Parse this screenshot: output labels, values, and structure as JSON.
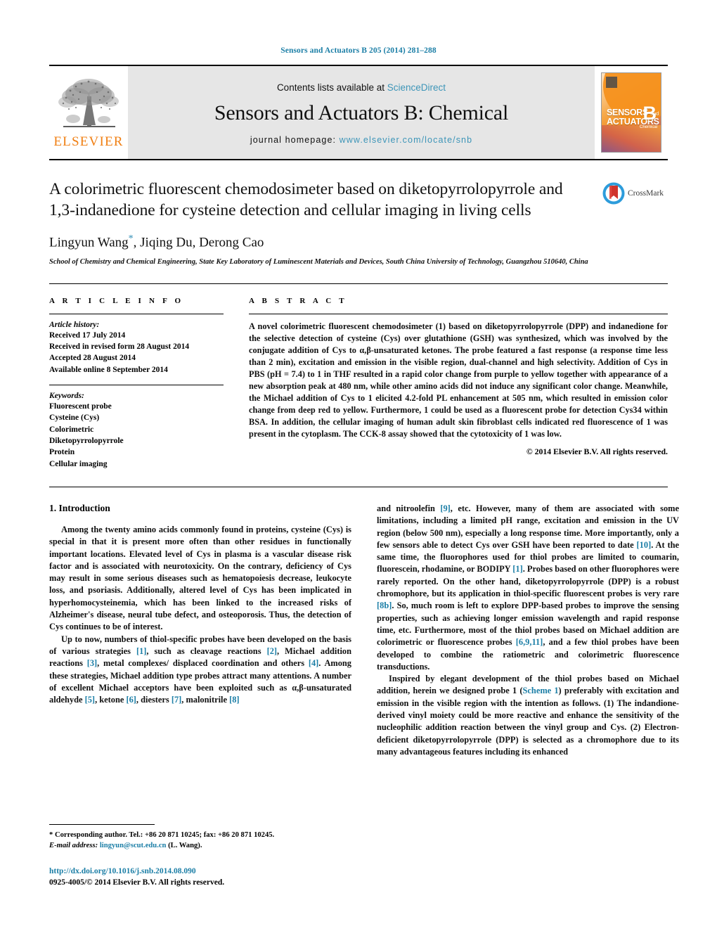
{
  "running_head": "Sensors and Actuators B 205 (2014) 281–288",
  "masthead": {
    "publisher_name": "ELSEVIER",
    "contents_prefix": "Contents lists available at ",
    "contents_link": "ScienceDirect",
    "journal_name": "Sensors and Actuators B: Chemical",
    "homepage_prefix": "journal homepage: ",
    "homepage_url": "www.elsevier.com/locate/snb",
    "cover": {
      "line1": "SENSORS",
      "and": "and",
      "line2": "ACTUATORS",
      "letter": "B",
      "sub": "Chemical"
    }
  },
  "crossmark": {
    "label": "CrossMark"
  },
  "title": "A colorimetric fluorescent chemodosimeter based on diketopyrrolopyrrole and 1,3-indanedione for cysteine detection and cellular imaging in living cells",
  "authors": "Lingyun Wang",
  "authors_rest": ", Jiqing Du, Derong Cao",
  "author_marker": "*",
  "affiliation": "School of Chemistry and Chemical Engineering, State Key Laboratory of Luminescent Materials and Devices, South China University of Technology, Guangzhou 510640, China",
  "article_info": {
    "heading": "A R T I C L E   I N F O",
    "history_label": "Article history:",
    "history": [
      "Received 17 July 2014",
      "Received in revised form 28 August 2014",
      "Accepted 28 August 2014",
      "Available online 8 September 2014"
    ],
    "keywords_label": "Keywords:",
    "keywords": [
      "Fluorescent probe",
      "Cysteine (Cys)",
      "Colorimetric",
      "Diketopyrrolopyrrole",
      "Protein",
      "Cellular imaging"
    ]
  },
  "abstract": {
    "heading": "A B S T R A C T",
    "text": "A novel colorimetric fluorescent chemodosimeter (1) based on diketopyrrolopyrrole (DPP) and indanedione for the selective detection of cysteine (Cys) over glutathione (GSH) was synthesized, which was involved by the conjugate addition of Cys to α,β-unsaturated ketones. The probe featured a fast response (a response time less than 2 min), excitation and emission in the visible region, dual-channel and high selectivity. Addition of Cys in PBS (pH = 7.4) to 1 in THF resulted in a rapid color change from purple to yellow together with appearance of a new absorption peak at 480 nm, while other amino acids did not induce any significant color change. Meanwhile, the Michael addition of Cys to 1 elicited 4.2-fold PL enhancement at 505 nm, which resulted in emission color change from deep red to yellow. Furthermore, 1 could be used as a fluorescent probe for detection Cys34 within BSA. In addition, the cellular imaging of human adult skin fibroblast cells indicated red fluorescence of 1 was present in the cytoplasm. The CCK-8 assay showed that the cytotoxicity of 1 was low.",
    "copyright": "© 2014 Elsevier B.V. All rights reserved."
  },
  "introduction": {
    "heading": "1.  Introduction",
    "p1": "Among the twenty amino acids commonly found in proteins, cysteine (Cys) is special in that it is present more often than other residues in functionally important locations. Elevated level of Cys in plasma is a vascular disease risk factor and is associated with neurotoxicity. On the contrary, deficiency of Cys may result in some serious diseases such as hematopoiesis decrease, leukocyte loss, and psoriasis. Additionally, altered level of Cys has been implicated in hyperhomocysteinemia, which has been linked to the increased risks of Alzheimer's disease, neural tube defect, and osteoporosis. Thus, the detection of Cys continues to be of interest.",
    "p2_a": "Up to now, numbers of thiol-specific probes have been developed on the basis of various strategies ",
    "p2_r1": "[1]",
    "p2_b": ", such as cleavage reactions ",
    "p2_r2": "[2]",
    "p2_c": ", Michael addition reactions ",
    "p2_r3": "[3]",
    "p2_d": ", metal complexes/ displaced coordination and others ",
    "p2_r4": "[4]",
    "p2_e": ". Among these strategies, Michael addition type probes attract many attentions. A number of excellent Michael acceptors have been exploited such as α,β-unsaturated aldehyde ",
    "p2_r5": "[5]",
    "p2_f": ", ketone ",
    "p2_r6": "[6]",
    "p2_g": ", diesters ",
    "p2_r7": "[7]",
    "p2_h": ", malonitrile ",
    "p2_r8": "[8]",
    "p3_a": "and nitroolefin ",
    "p3_r1": "[9]",
    "p3_b": ", etc. However, many of them are associated with some limitations, including a limited pH range, excitation and emission in the UV region (below 500 nm), especially a long response time. More importantly, only a few sensors able to detect Cys over GSH have been reported to date ",
    "p3_r2": "[10]",
    "p3_c": ". At the same time, the fluorophores used for thiol probes are limited to coumarin, fluorescein, rhodamine, or BODIPY ",
    "p3_r3": "[1]",
    "p3_d": ". Probes based on other fluorophores were rarely reported. On the other hand, diketopyrrolopyrrole (DPP) is a robust chromophore, but its application in thiol-specific fluorescent probes is very rare ",
    "p3_r4": "[8b]",
    "p3_e": ". So, much room is left to explore DPP-based probes to improve the sensing properties, such as achieving longer emission wavelength and rapid response time, etc. Furthermore, most of the thiol probes based on Michael addition are colorimetric or fluorescence probes ",
    "p3_r5": "[6,9,11]",
    "p3_f": ", and a few thiol probes have been developed to combine the ratiometric and colorimetric fluorescence transductions.",
    "p4_a": "Inspired by elegant development of the thiol probes based on Michael addition, herein we designed probe 1 (",
    "p4_r1": "Scheme 1",
    "p4_b": ") preferably with excitation and emission in the visible region with the intention as follows. (1) The indandione-derived vinyl moiety could be more reactive and enhance the sensitivity of the nucleophilic addition reaction between the vinyl group and Cys. (2) Electron-deficient diketopyrrolopyrrole (DPP) is selected as a chromophore due to its many advantageous features including its enhanced"
  },
  "footnotes": {
    "corresponding": "* Corresponding author. Tel.: +86 20 871 10245; fax: +86 20 871 10245.",
    "email_label": "E-mail address: ",
    "email": "lingyun@scut.edu.cn",
    "email_suffix": " (L. Wang).",
    "doi": "http://dx.doi.org/10.1016/j.snb.2014.08.090",
    "issn": "0925-4005/© 2014 Elsevier B.V. All rights reserved."
  },
  "colors": {
    "link": "#1b7ea6",
    "elsevier_orange": "#f07f13",
    "band_gray": "#e6e6e6"
  }
}
